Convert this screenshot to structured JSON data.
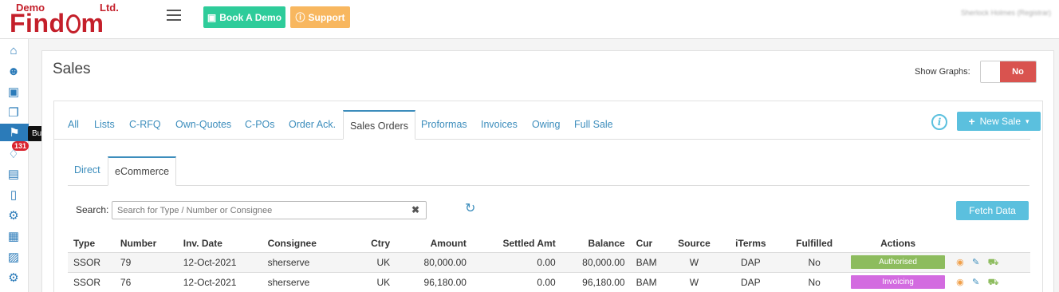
{
  "brand": {
    "logo_text": "Find",
    "logo_demo": "Demo",
    "logo_ltd": "Ltd.",
    "logo_tail": "m",
    "color": "#c41f2a"
  },
  "header": {
    "book_demo_label": "Book A Demo",
    "support_label": "Support",
    "user_name": "Sherlock Holmes (Registrar)"
  },
  "sidebar": {
    "items": [
      {
        "icon": "home-icon"
      },
      {
        "icon": "contacts-icon"
      },
      {
        "icon": "box-icon"
      },
      {
        "icon": "documents-icon"
      },
      {
        "icon": "signpost-icon",
        "active": true
      },
      {
        "icon": "bell-icon"
      },
      {
        "icon": "invoice-icon"
      },
      {
        "icon": "bookmark-icon"
      },
      {
        "icon": "wrench-icon"
      },
      {
        "icon": "hierarchy-icon"
      },
      {
        "icon": "id-card-icon"
      },
      {
        "icon": "gear-icon"
      }
    ],
    "badge": "131",
    "tooltip": "Buy, Sell + Ship"
  },
  "page": {
    "title": "Sales",
    "show_graphs_label": "Show Graphs:",
    "toggle_value": "No"
  },
  "tabs": [
    "All",
    "Lists",
    "C-RFQ",
    "Own-Quotes",
    "C-POs",
    "Order Ack.",
    "Sales Orders",
    "Proformas",
    "Invoices",
    "Owing",
    "Full Sale"
  ],
  "active_tab": "Sales Orders",
  "new_sale_label": "New Sale",
  "subtabs": [
    "Direct",
    "eCommerce"
  ],
  "active_subtab": "eCommerce",
  "search": {
    "label": "Search:",
    "placeholder": "Search for Type / Number or Consignee",
    "value": ""
  },
  "fetch_label": "Fetch Data",
  "table": {
    "columns": [
      "Type",
      "Number",
      "Inv. Date",
      "Consignee",
      "Ctry",
      "Amount",
      "Settled Amt",
      "Balance",
      "Cur",
      "Source",
      "iTerms",
      "Fulfilled",
      "Actions"
    ],
    "rows": [
      {
        "type": "SSOR",
        "number": "79",
        "date": "12-Oct-2021",
        "consignee": "sherserve",
        "ctry": "UK",
        "amount": "80,000.00",
        "settled": "0.00",
        "balance": "80,000.00",
        "cur": "BAM",
        "source": "W",
        "iterms": "DAP",
        "fulfilled": "No",
        "status": "Authorised",
        "status_color": "#8dbc5e"
      },
      {
        "type": "SSOR",
        "number": "76",
        "date": "12-Oct-2021",
        "consignee": "sherserve",
        "ctry": "UK",
        "amount": "96,180.00",
        "settled": "0.00",
        "balance": "96,180.00",
        "cur": "BAM",
        "source": "W",
        "iterms": "DAP",
        "fulfilled": "No",
        "status": "Invoicing",
        "status_color": "#d36be0"
      }
    ]
  },
  "colors": {
    "accent": "#3c8dbc",
    "info": "#5bc0de",
    "danger": "#d9534f",
    "success": "#2ecc9a",
    "warning": "#f8b75f"
  }
}
